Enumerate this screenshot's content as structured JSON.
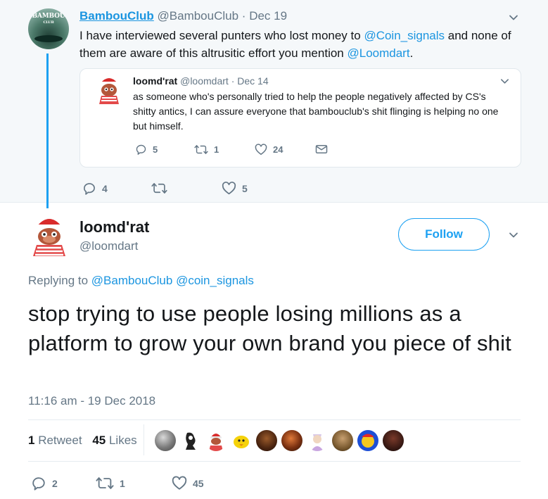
{
  "parent_tweet": {
    "avatar_text": "BAMBOU",
    "avatar_subtext": "CLUB",
    "name": "BambouClub",
    "handle": "@BambouClub",
    "separator": "·",
    "date": "Dec 19",
    "text_parts": {
      "t1": "I have interviewed several punters who lost money to ",
      "mention1": "@Coin_signals",
      "t2": " and none of them are aware of this altrusitic effort you mention ",
      "mention2": "@Loomdart",
      "t3": "."
    },
    "quote": {
      "name": "loomd'rat",
      "handle": "@loomdart",
      "separator": "·",
      "date": "Dec 14",
      "text": "as someone who's personally tried to help the people negatively affected by CS's shitty antics, I can assure everyone that bambouclub's shit flinging is helping no one but himself.",
      "replies": "5",
      "retweets": "1",
      "likes": "24"
    },
    "replies": "4",
    "retweets": "",
    "likes": "5"
  },
  "main_tweet": {
    "name": "loomd'rat",
    "handle": "@loomdart",
    "follow_label": "Follow",
    "replying_label": "Replying to ",
    "reply_mention1": "@BambouClub",
    "reply_mention2": "@coin_signals",
    "text": "stop trying to use people losing millions as a platform to grow your own brand you piece of shit",
    "timestamp": "11:16 am - 19 Dec 2018",
    "retweet_count": "1",
    "retweet_label": "Retweet",
    "like_count": "45",
    "like_label": "Likes",
    "replies": "2",
    "retweets": "1",
    "likes": "45"
  },
  "colors": {
    "accent": "#1da1f2",
    "link": "#1b95e0",
    "muted": "#657786",
    "thread_bg": "#f5f8fa"
  },
  "icons": [
    "chevron-down-icon",
    "reply-icon",
    "retweet-icon",
    "like-icon",
    "direct-message-icon"
  ]
}
